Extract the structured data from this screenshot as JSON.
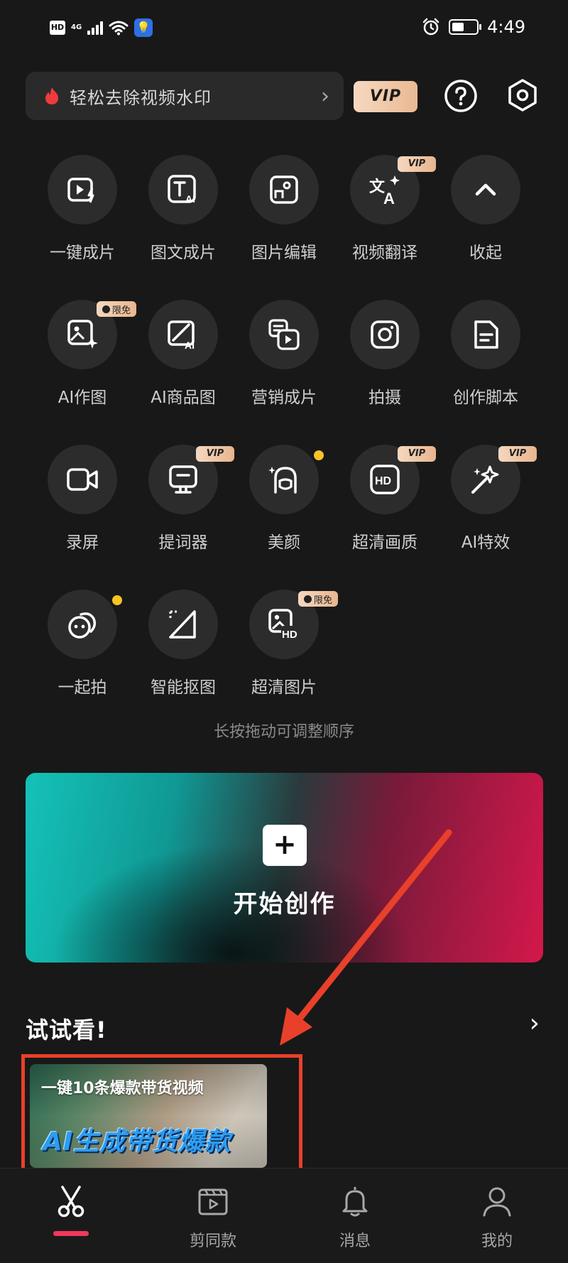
{
  "status_bar": {
    "hd": "HD",
    "network": "4G",
    "time": "4:49"
  },
  "top": {
    "promo_text": "轻松去除视频水印",
    "vip_label": "VIP"
  },
  "tools": [
    {
      "label": "一键成片",
      "icon": "video-spark-icon"
    },
    {
      "label": "图文成片",
      "icon": "text-ai-icon"
    },
    {
      "label": "图片编辑",
      "icon": "image-edit-icon"
    },
    {
      "label": "视频翻译",
      "icon": "translate-icon",
      "tag": "VIP"
    },
    {
      "label": "收起",
      "icon": "chevron-up-icon"
    },
    {
      "label": "AI作图",
      "icon": "ai-image-icon",
      "tag": "限免"
    },
    {
      "label": "AI商品图",
      "icon": "ai-product-icon"
    },
    {
      "label": "营销成片",
      "icon": "marketing-video-icon"
    },
    {
      "label": "拍摄",
      "icon": "camera-icon"
    },
    {
      "label": "创作脚本",
      "icon": "script-icon"
    },
    {
      "label": "录屏",
      "icon": "screen-record-icon"
    },
    {
      "label": "提词器",
      "icon": "teleprompter-icon",
      "tag": "VIP"
    },
    {
      "label": "美颜",
      "icon": "beauty-icon",
      "dot": true
    },
    {
      "label": "超清画质",
      "icon": "hd-quality-icon",
      "tag": "VIP"
    },
    {
      "label": "AI特效",
      "icon": "ai-effects-icon",
      "tag": "VIP"
    },
    {
      "label": "一起拍",
      "icon": "shoot-together-icon",
      "dot": true
    },
    {
      "label": "智能抠图",
      "icon": "smart-cutout-icon"
    },
    {
      "label": "超清图片",
      "icon": "hd-image-icon",
      "tag": "限免"
    }
  ],
  "hint": "长按拖动可调整顺序",
  "create": {
    "label": "开始创作",
    "plus": "+"
  },
  "try": {
    "title": "试试看!",
    "card_title": "一键10条爆款带货视频",
    "card_subtitle": "AI生成带货爆款"
  },
  "nav": [
    {
      "label": "",
      "icon": "scissors-icon",
      "active": true
    },
    {
      "label": "剪同款",
      "icon": "template-icon"
    },
    {
      "label": "消息",
      "icon": "bell-icon"
    },
    {
      "label": "我的",
      "icon": "profile-icon"
    }
  ],
  "colors": {
    "background": "#181818",
    "accent_red": "#f2385a",
    "vip_gold": "#f5d8bf",
    "annotation_red": "#e8402a",
    "teal": "#14c2b7",
    "crimson": "#d3184b"
  }
}
